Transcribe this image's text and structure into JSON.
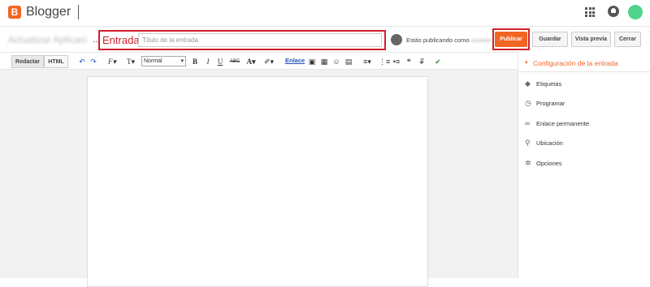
{
  "app": {
    "brand": "Blogger",
    "logo_letter": "B"
  },
  "header": {
    "apps_icon": "apps-grid-icon",
    "notifications_icon": "bell-icon",
    "account_icon": "avatar"
  },
  "titlebar": {
    "blog_name": "Actualizar Aplicaci",
    "ellipsis": "...",
    "annotation_label": "Entrada",
    "title_placeholder": "Título de la entrada",
    "publishing_as": "Estás publicando como",
    "publishing_name": "usuario",
    "publish": "Publicar",
    "save": "Guardar",
    "preview": "Vista previa",
    "close": "Cerrar"
  },
  "toolbar": {
    "compose": "Redactar",
    "html": "HTML",
    "undo": "↶",
    "redo": "↷",
    "font_family": "F",
    "font_size": "T",
    "format": "Normal",
    "bold": "B",
    "italic": "I",
    "underline": "U",
    "strike": "ABC",
    "text_color": "A",
    "link": "Enlace",
    "align": "≡",
    "quote": "❝"
  },
  "sidebar": {
    "title": "Configuración de la entrada",
    "items": [
      {
        "label": "Etiquetas",
        "icon": "tag-icon"
      },
      {
        "label": "Programar",
        "icon": "clock-icon"
      },
      {
        "label": "Enlace permanente",
        "icon": "link-icon"
      },
      {
        "label": "Ubicación",
        "icon": "location-pin-icon"
      },
      {
        "label": "Opciones",
        "icon": "gear-icon"
      }
    ]
  },
  "colors": {
    "accent": "#f26522",
    "annotation": "#d21f2a",
    "link": "#2255bb"
  }
}
